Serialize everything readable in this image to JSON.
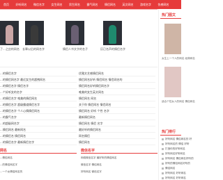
{
  "nav": {
    "items": [
      "首页",
      "好听网名",
      "微信名字",
      "女生网名",
      "男生网名",
      "霸气网名",
      "情侣网名",
      "英文网名",
      "游戏名字",
      "伤感网名"
    ]
  },
  "thumbs": [
    {
      "caption": "了...之应的网名",
      "color": "#c9a6a6"
    },
    {
      "caption": "长辈以后的网名字",
      "color": "#3a3a3a"
    },
    {
      "caption": "情侣人书文字的名子",
      "color": "#6a5f73"
    },
    {
      "caption": "历已名声的情侣名字",
      "color": "#1f8a6e"
    }
  ],
  "list": {
    "left": [
      "...的情侣名字",
      "...的情侣网名字 最近女生的超拽网名",
      "...的情侣名字 情侣名字",
      "...个好听女的名字",
      "...的情侣名字 唯美的情侣网名",
      "...的情侣名字 超级霸道情侣名字",
      "...的情侣名字 个人心情情侣网名",
      "...的霸气名字",
      "...的超级网名字",
      "...情侣网名 最新网名",
      "...的情侣名 情侣网名",
      "...的情侣名字 最新情侣名字"
    ],
    "right": [
      "优雅文艺感情侣网名",
      "情侣网名好听 情侣网名 情侣网名的",
      "情侣网名好听情侣网名字",
      "唯美的女生英文网名",
      "情侣网名 网名",
      "关于你 情侣网名 情侣网名",
      "情侣网名 好听 个性 名字",
      "最新情侣网名",
      "情侣网名 情侣 名字",
      "最好听的情侣网名",
      "网名情侣",
      "情侣网名"
    ]
  },
  "sections": {
    "left_title": "网名",
    "left_items": [
      "...情侣网名",
      "...的情侣网名字",
      "...一个女情侣网名的"
    ],
    "right_title": "微信名字",
    "right_items": [
      "网络微信名字 最好听的情侣网名",
      "微信名字 情侣网名",
      "好听网名 微信名字"
    ]
  },
  "sidebar": {
    "hot_title": "热门图文",
    "hot_items": [
      {
        "caption": "女生上一个人的网名 经典网名",
        "color": "#cfb5a6"
      },
      {
        "caption": "适合个性女人的网名 情侣网名",
        "color": "#e1c7c4"
      }
    ],
    "rank_title": "热门排行",
    "rank_items": [
      "好听网名 情侣网名的 好",
      "好听网名的 情侣 好听",
      "打造你的好听网名",
      "好听网名好听网名",
      "好听网名 情侣网名好听的",
      "好听的情侣网名好听的",
      "情侣网名",
      "好听网名 好听网名",
      "好听网名 好听网名"
    ]
  }
}
